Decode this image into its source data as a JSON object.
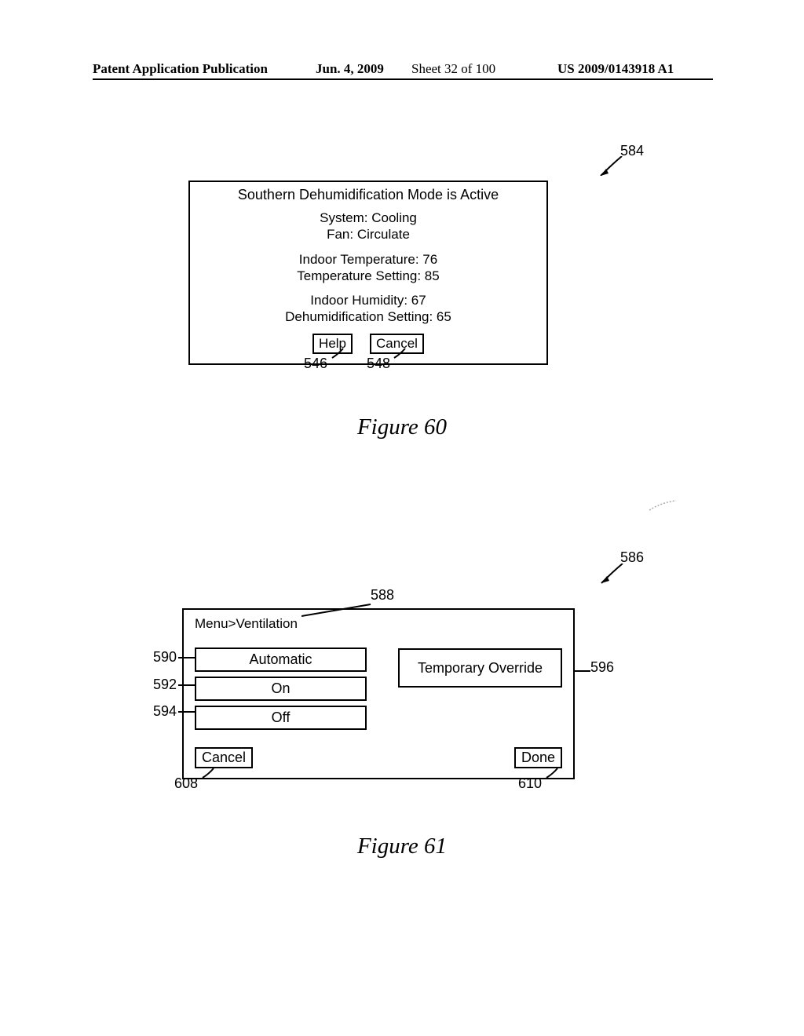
{
  "header": {
    "publication_label": "Patent Application Publication",
    "date": "Jun. 4, 2009",
    "sheet": "Sheet 32 of 100",
    "pubnum": "US 2009/0143918 A1"
  },
  "fig60": {
    "screen_ref": "584",
    "title": "Southern Dehumidification Mode is Active",
    "system_line": "System: Cooling",
    "fan_line": "Fan: Circulate",
    "indoor_temp_line": "Indoor Temperature: 76",
    "temp_setting_line": "Temperature Setting: 85",
    "indoor_humidity_line": "Indoor Humidity: 67",
    "dehum_setting_line": "Dehumidification Setting: 65",
    "help_label": "Help",
    "cancel_label": "Cancel",
    "help_ref": "546",
    "cancel_ref": "548",
    "caption": "Figure 60"
  },
  "fig61": {
    "screen_ref": "586",
    "breadcrumb": "Menu>Ventilation",
    "breadcrumb_ref": "588",
    "automatic_label": "Automatic",
    "automatic_ref": "590",
    "on_label": "On",
    "on_ref": "592",
    "off_label": "Off",
    "off_ref": "594",
    "override_label": "Temporary Override",
    "override_ref": "596",
    "cancel_label": "Cancel",
    "cancel_ref": "608",
    "done_label": "Done",
    "done_ref": "610",
    "caption": "Figure 61"
  }
}
